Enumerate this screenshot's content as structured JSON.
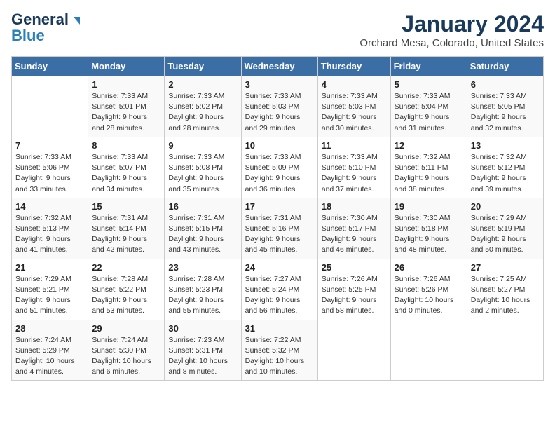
{
  "header": {
    "logo_line1": "General",
    "logo_line2": "Blue",
    "title": "January 2024",
    "subtitle": "Orchard Mesa, Colorado, United States"
  },
  "days_of_week": [
    "Sunday",
    "Monday",
    "Tuesday",
    "Wednesday",
    "Thursday",
    "Friday",
    "Saturday"
  ],
  "weeks": [
    [
      {
        "day": "",
        "info": ""
      },
      {
        "day": "1",
        "info": "Sunrise: 7:33 AM\nSunset: 5:01 PM\nDaylight: 9 hours\nand 28 minutes."
      },
      {
        "day": "2",
        "info": "Sunrise: 7:33 AM\nSunset: 5:02 PM\nDaylight: 9 hours\nand 28 minutes."
      },
      {
        "day": "3",
        "info": "Sunrise: 7:33 AM\nSunset: 5:03 PM\nDaylight: 9 hours\nand 29 minutes."
      },
      {
        "day": "4",
        "info": "Sunrise: 7:33 AM\nSunset: 5:03 PM\nDaylight: 9 hours\nand 30 minutes."
      },
      {
        "day": "5",
        "info": "Sunrise: 7:33 AM\nSunset: 5:04 PM\nDaylight: 9 hours\nand 31 minutes."
      },
      {
        "day": "6",
        "info": "Sunrise: 7:33 AM\nSunset: 5:05 PM\nDaylight: 9 hours\nand 32 minutes."
      }
    ],
    [
      {
        "day": "7",
        "info": "Sunrise: 7:33 AM\nSunset: 5:06 PM\nDaylight: 9 hours\nand 33 minutes."
      },
      {
        "day": "8",
        "info": "Sunrise: 7:33 AM\nSunset: 5:07 PM\nDaylight: 9 hours\nand 34 minutes."
      },
      {
        "day": "9",
        "info": "Sunrise: 7:33 AM\nSunset: 5:08 PM\nDaylight: 9 hours\nand 35 minutes."
      },
      {
        "day": "10",
        "info": "Sunrise: 7:33 AM\nSunset: 5:09 PM\nDaylight: 9 hours\nand 36 minutes."
      },
      {
        "day": "11",
        "info": "Sunrise: 7:33 AM\nSunset: 5:10 PM\nDaylight: 9 hours\nand 37 minutes."
      },
      {
        "day": "12",
        "info": "Sunrise: 7:32 AM\nSunset: 5:11 PM\nDaylight: 9 hours\nand 38 minutes."
      },
      {
        "day": "13",
        "info": "Sunrise: 7:32 AM\nSunset: 5:12 PM\nDaylight: 9 hours\nand 39 minutes."
      }
    ],
    [
      {
        "day": "14",
        "info": "Sunrise: 7:32 AM\nSunset: 5:13 PM\nDaylight: 9 hours\nand 41 minutes."
      },
      {
        "day": "15",
        "info": "Sunrise: 7:31 AM\nSunset: 5:14 PM\nDaylight: 9 hours\nand 42 minutes."
      },
      {
        "day": "16",
        "info": "Sunrise: 7:31 AM\nSunset: 5:15 PM\nDaylight: 9 hours\nand 43 minutes."
      },
      {
        "day": "17",
        "info": "Sunrise: 7:31 AM\nSunset: 5:16 PM\nDaylight: 9 hours\nand 45 minutes."
      },
      {
        "day": "18",
        "info": "Sunrise: 7:30 AM\nSunset: 5:17 PM\nDaylight: 9 hours\nand 46 minutes."
      },
      {
        "day": "19",
        "info": "Sunrise: 7:30 AM\nSunset: 5:18 PM\nDaylight: 9 hours\nand 48 minutes."
      },
      {
        "day": "20",
        "info": "Sunrise: 7:29 AM\nSunset: 5:19 PM\nDaylight: 9 hours\nand 50 minutes."
      }
    ],
    [
      {
        "day": "21",
        "info": "Sunrise: 7:29 AM\nSunset: 5:21 PM\nDaylight: 9 hours\nand 51 minutes."
      },
      {
        "day": "22",
        "info": "Sunrise: 7:28 AM\nSunset: 5:22 PM\nDaylight: 9 hours\nand 53 minutes."
      },
      {
        "day": "23",
        "info": "Sunrise: 7:28 AM\nSunset: 5:23 PM\nDaylight: 9 hours\nand 55 minutes."
      },
      {
        "day": "24",
        "info": "Sunrise: 7:27 AM\nSunset: 5:24 PM\nDaylight: 9 hours\nand 56 minutes."
      },
      {
        "day": "25",
        "info": "Sunrise: 7:26 AM\nSunset: 5:25 PM\nDaylight: 9 hours\nand 58 minutes."
      },
      {
        "day": "26",
        "info": "Sunrise: 7:26 AM\nSunset: 5:26 PM\nDaylight: 10 hours\nand 0 minutes."
      },
      {
        "day": "27",
        "info": "Sunrise: 7:25 AM\nSunset: 5:27 PM\nDaylight: 10 hours\nand 2 minutes."
      }
    ],
    [
      {
        "day": "28",
        "info": "Sunrise: 7:24 AM\nSunset: 5:29 PM\nDaylight: 10 hours\nand 4 minutes."
      },
      {
        "day": "29",
        "info": "Sunrise: 7:24 AM\nSunset: 5:30 PM\nDaylight: 10 hours\nand 6 minutes."
      },
      {
        "day": "30",
        "info": "Sunrise: 7:23 AM\nSunset: 5:31 PM\nDaylight: 10 hours\nand 8 minutes."
      },
      {
        "day": "31",
        "info": "Sunrise: 7:22 AM\nSunset: 5:32 PM\nDaylight: 10 hours\nand 10 minutes."
      },
      {
        "day": "",
        "info": ""
      },
      {
        "day": "",
        "info": ""
      },
      {
        "day": "",
        "info": ""
      }
    ]
  ]
}
